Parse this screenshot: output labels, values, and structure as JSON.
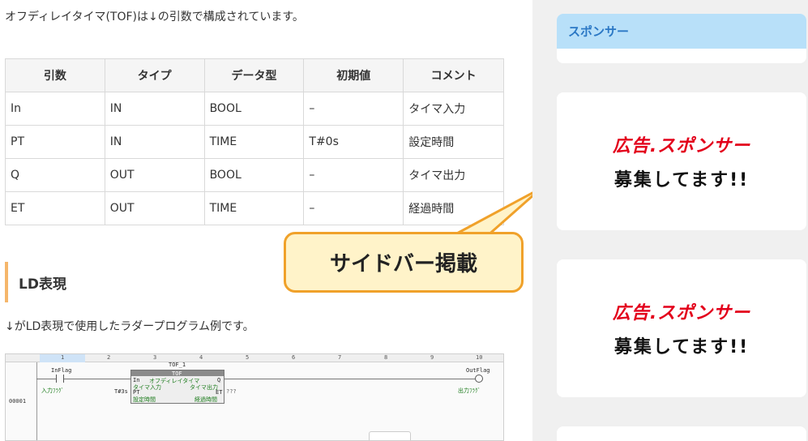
{
  "main": {
    "intro": "オフディレイタイマ(TOF)は↓の引数で構成されています。",
    "table": {
      "headers": [
        "引数",
        "タイプ",
        "データ型",
        "初期値",
        "コメント"
      ],
      "rows": [
        [
          "In",
          "IN",
          "BOOL",
          "–",
          "タイマ入力"
        ],
        [
          "PT",
          "IN",
          "TIME",
          "T#0s",
          "設定時間"
        ],
        [
          "Q",
          "OUT",
          "BOOL",
          "–",
          "タイマ出力"
        ],
        [
          "ET",
          "OUT",
          "TIME",
          "–",
          "経過時間"
        ]
      ]
    },
    "section_title": "LD表現",
    "ld_desc": "↓がLD表現で使用したラダープログラム例です。",
    "ladder": {
      "columns": [
        "1",
        "2",
        "3",
        "4",
        "5",
        "6",
        "7",
        "8",
        "9",
        "10"
      ],
      "row_number": "00001",
      "input_label": "InFlag",
      "input_comment": "入力ﾌﾗｸﾞ",
      "output_label": "OutFlag",
      "output_comment": "出力ﾌﾗｸﾞ",
      "fb_instance": "TOF_1",
      "fb_type": "TOF",
      "fb_pin_in": "In",
      "fb_pin_q": "Q",
      "fb_pin_pt": "PT",
      "fb_pin_et": "ET",
      "fb_comment_top": "オフディレイタイマ",
      "fb_in_comment": "タイマ入力",
      "fb_q_comment": "タイマ出力",
      "fb_pt_comment": "設定時間",
      "fb_et_comment": "経過時間",
      "pt_value": "T#3s",
      "et_value": "???"
    }
  },
  "sidebar": {
    "sponsor_title": "スポンサー",
    "ads": [
      {
        "line1": "広告.スポンサー",
        "line2": "募集してます!!"
      },
      {
        "line1": "広告.スポンサー",
        "line2": "募集してます!!"
      }
    ]
  },
  "annotation": {
    "text": "サイドバー掲載"
  },
  "colors": {
    "accent_bar": "#f5b66b",
    "sponsor_header_bg": "#b8e0f9",
    "sponsor_header_text": "#2b78c5",
    "ad_red": "#e3001b",
    "callout_fill": "#fff3c9",
    "callout_border": "#f0a12a"
  }
}
